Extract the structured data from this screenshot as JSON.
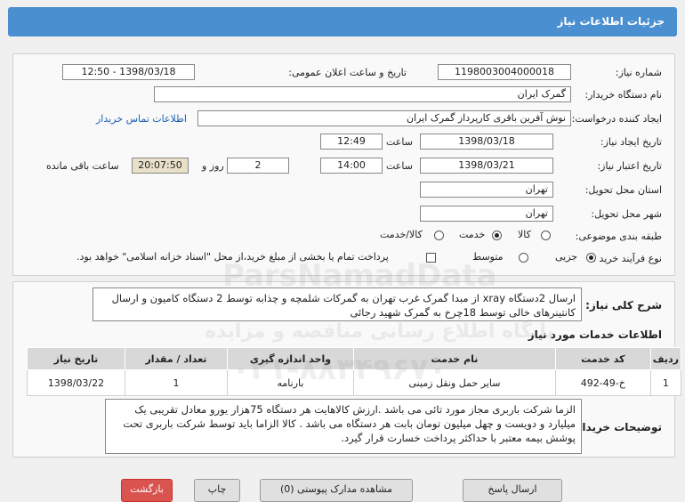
{
  "header": {
    "title": "جزئیات اطلاعات نیاز"
  },
  "form": {
    "need_number_label": "شماره نیاز:",
    "need_number": "1198003004000018",
    "announce_label": "تاریخ و ساعت اعلان عمومی:",
    "announce_value": "1398/03/18 - 12:50",
    "buyer_label": "نام دستگاه خریدار:",
    "buyer_value": "گمرک ایران",
    "creator_label": "ایجاد کننده درخواست:",
    "creator_value": "نوش آفرین باقری کارپرداز گمرک ایران",
    "contact_link": "اطلاعات تماس خریدار",
    "created_label": "تاریخ ایجاد نیاز:",
    "created_date": "1398/03/18",
    "time_label": "ساعت",
    "created_time": "12:49",
    "validity_label": "تاریخ اعتبار نیاز:",
    "validity_date": "1398/03/21",
    "validity_time": "14:00",
    "days_value": "2",
    "days_label": "روز و",
    "remaining_time": "20:07:50",
    "remaining_label": "ساعت باقی مانده",
    "province_label": "استان محل تحویل:",
    "province_value": "تهران",
    "city_label": "شهر محل تحویل:",
    "city_value": "تهران",
    "category_label": "طبقه بندی موضوعی:",
    "category_options": [
      "کالا",
      "خدمت",
      "کالا/خدمت"
    ],
    "category_selected": 1,
    "process_label": "نوع فرآیند خرید :",
    "process_options": [
      "جزیی",
      "متوسط"
    ],
    "process_selected": 0,
    "payment_note": "پرداخت تمام یا بخشی از مبلغ خرید،از محل \"اسناد خزانه اسلامی\" خواهد بود."
  },
  "description": {
    "label": "شرح کلی نیاز:",
    "text": "ارسال 2دستگاه xray از مبدا گمرک غرب تهران به گمرکات شلمچه و چذابه توسط 2 دستگاه کامیون و ارسال کانتینرهای خالی توسط  18چرخ به گمرک شهید رجائی"
  },
  "services": {
    "title": "اطلاعات خدمات مورد نیاز",
    "columns": [
      "ردیف",
      "کد خدمت",
      "نام خدمت",
      "واحد اندازه گیری",
      "تعداد / مقدار",
      "تاریخ نیاز"
    ],
    "rows": [
      [
        "1",
        "خ-49-492",
        "سایر حمل ونقل زمینی",
        "بارنامه",
        "1",
        "1398/03/22"
      ]
    ]
  },
  "buyer_notes": {
    "label": "توضیحات خریدار:",
    "text": "الزما شرکت باربری مجاز مورد تائی می باشد .ارزش کالاهایت هر دستگاه 75هزار یورو  معادل تقریبی یک میلیارد و دویست و چهل میلیون تومان بابت هر دستگاه می باشد . کالا الزاما باید توسط شرکت باربری تحت پوشش بیمه معتبر با حداکثر پرداخت خسارت قرار گیرد."
  },
  "watermark": {
    "line1": "ParsNamadData",
    "line2": "پایگاه اطلاع رسانی مناقصه و مزایده",
    "line3": "۰۲۱-۸۸۳۴۹۶۷۰"
  },
  "bottom_buttons": {
    "back": "بازگشت",
    "print": "چاپ",
    "attachments": "مشاهده مدارک پیوستی (0)",
    "reply": "ارسال پاسخ"
  }
}
